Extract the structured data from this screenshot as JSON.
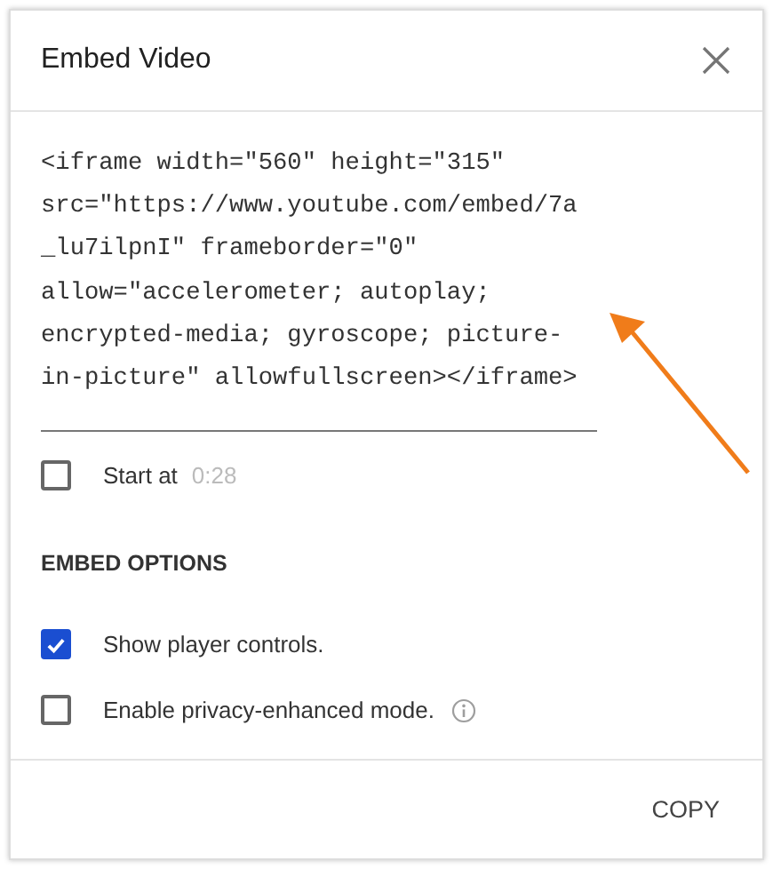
{
  "dialog": {
    "title": "Embed Video"
  },
  "code_lines": [
    "<iframe width=\"560\" height=\"315\"",
    "src=\"https://www.youtube.com/embed/7a",
    "_lu7ilpnI\" frameborder=\"0\"",
    "allow=\"accelerometer; autoplay;",
    "encrypted-media; gyroscope; picture-",
    "in-picture\" allowfullscreen></iframe>"
  ],
  "start_at": {
    "label": "Start at",
    "value": "0:28",
    "checked": false
  },
  "section_heading": "EMBED OPTIONS",
  "options": [
    {
      "label": "Show player controls.",
      "checked": true,
      "info": false
    },
    {
      "label": "Enable privacy-enhanced mode.",
      "checked": false,
      "info": true
    }
  ],
  "buttons": [
    "COPY"
  ]
}
